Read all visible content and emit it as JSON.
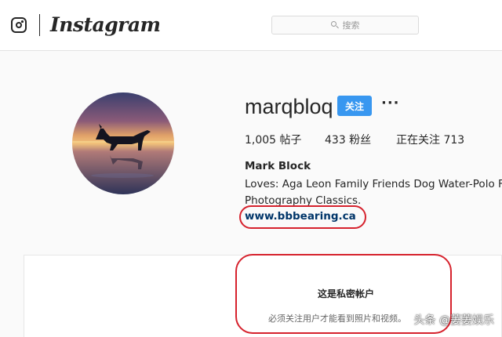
{
  "header": {
    "app_name": "Instagram",
    "search_placeholder": "搜索"
  },
  "profile": {
    "username": "marqbloq",
    "follow_label": "关注",
    "more_label": "···",
    "stats": {
      "posts": "1,005 帖子",
      "followers": "433 粉丝",
      "following": "正在关注 713"
    },
    "full_name": "Mark Block",
    "bio_lines": [
      "Loves: Aga Leon Family Friends Dog Water-Polo Football",
      "Photography Classics."
    ],
    "website": "www.bbbearing.ca"
  },
  "private_notice": {
    "title": "这是私密帐户",
    "subtitle": "必须关注用户才能看到照片和视频。"
  },
  "watermark": "头条 @萋萋娱乐",
  "colors": {
    "follow_button": "#3897f0",
    "annotation_oval": "#d6222d",
    "website_link": "#003569"
  }
}
